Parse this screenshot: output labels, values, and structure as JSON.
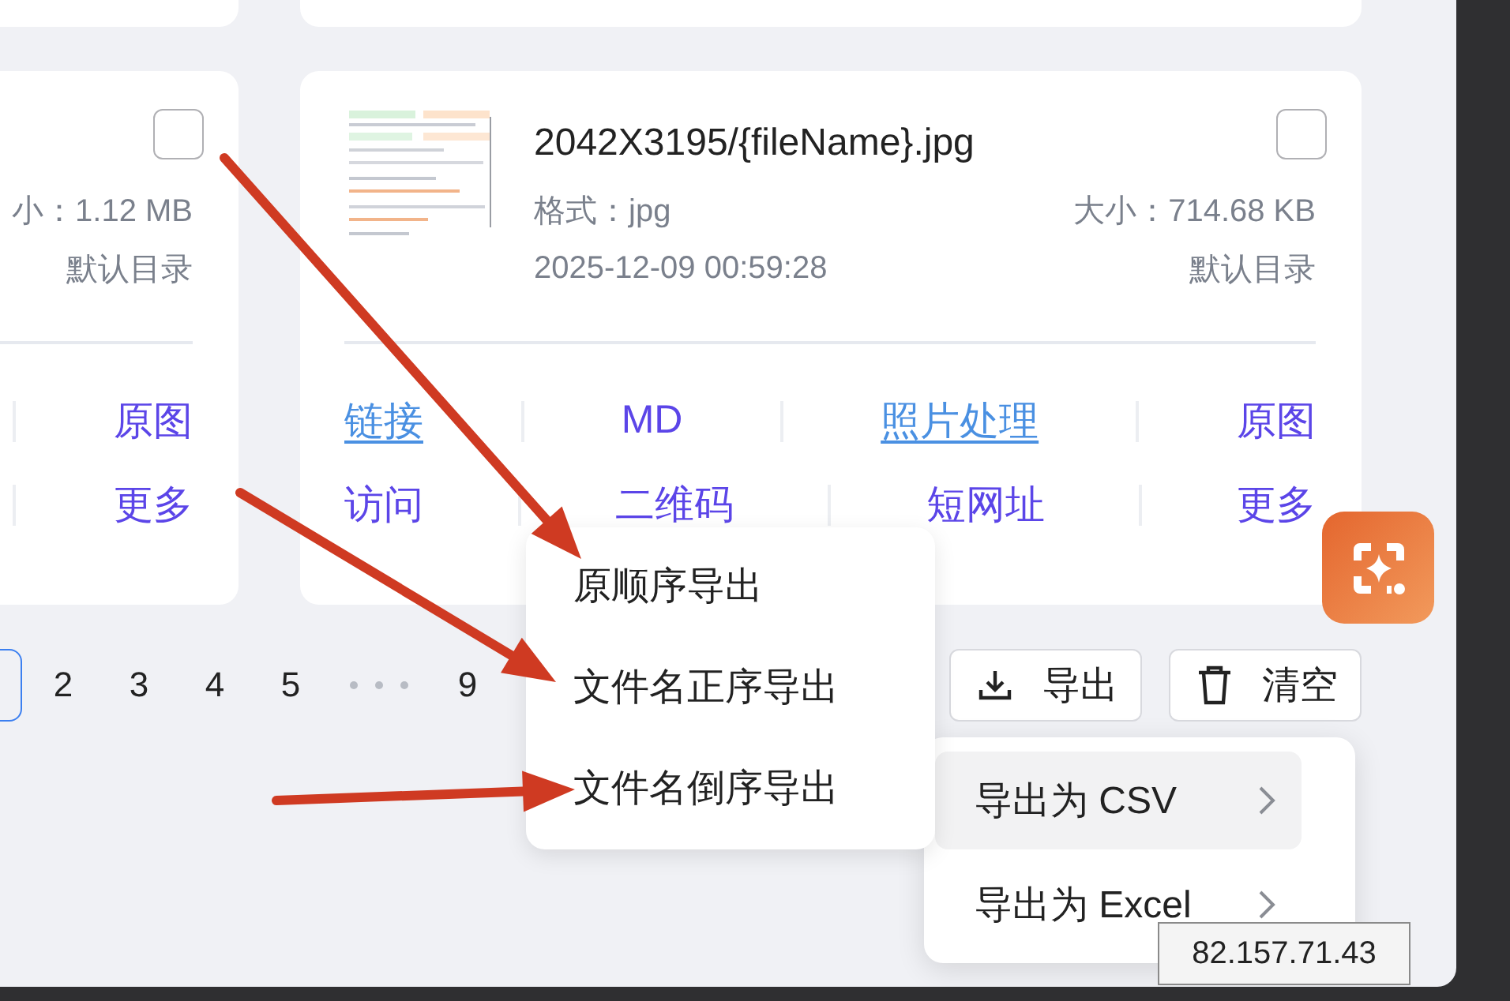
{
  "top_cards": [
    {
      "kind": "card"
    },
    {
      "kind": "card"
    }
  ],
  "cards": [
    {
      "kind": "partial",
      "checked": false,
      "size": "小：1.12 MB",
      "folder": "默认目录",
      "action_rows": [
        [
          {
            "label": "原图",
            "kind": "plain"
          }
        ],
        [
          {
            "label": "更多",
            "kind": "plain"
          }
        ]
      ]
    },
    {
      "kind": "full",
      "checked": false,
      "title": "2042X3195/{fileName}.jpg",
      "format": "格式：jpg",
      "size": "大小：714.68 KB",
      "date": "2025-12-09 00:59:28",
      "folder": "默认目录",
      "action_rows": [
        [
          {
            "label": "链接",
            "kind": "link"
          },
          {
            "label": "MD",
            "kind": "plain"
          },
          {
            "label": "照片处理",
            "kind": "link"
          },
          {
            "label": "原图",
            "kind": "plain"
          }
        ],
        [
          {
            "label": "访问",
            "kind": "plain"
          },
          {
            "label": "二维码",
            "kind": "plain"
          },
          {
            "label": "短网址",
            "kind": "plain"
          },
          {
            "label": "更多",
            "kind": "plain"
          }
        ]
      ]
    }
  ],
  "pagination": {
    "pages": [
      {
        "kind": "page",
        "selected": true
      },
      {
        "kind": "page",
        "label": "2",
        "selected": false
      },
      {
        "kind": "page",
        "label": "3",
        "selected": false
      },
      {
        "kind": "page",
        "label": "4",
        "selected": false
      },
      {
        "kind": "page",
        "label": "5",
        "selected": false
      },
      {
        "kind": "ellipsis"
      },
      {
        "kind": "page",
        "label": "9",
        "selected": false
      }
    ]
  },
  "toolbar": {
    "buttons": [
      {
        "label": "导出"
      },
      {
        "label": "清空"
      }
    ]
  },
  "export_menu": {
    "items": [
      "原顺序导出",
      "文件名正序导出",
      "文件名倒序导出"
    ]
  },
  "export_submenu": {
    "items": [
      {
        "label": "导出为 CSV",
        "selected": true
      },
      {
        "label": "导出为 Excel",
        "selected": false
      }
    ]
  },
  "tooltip": "82.157.71.43"
}
